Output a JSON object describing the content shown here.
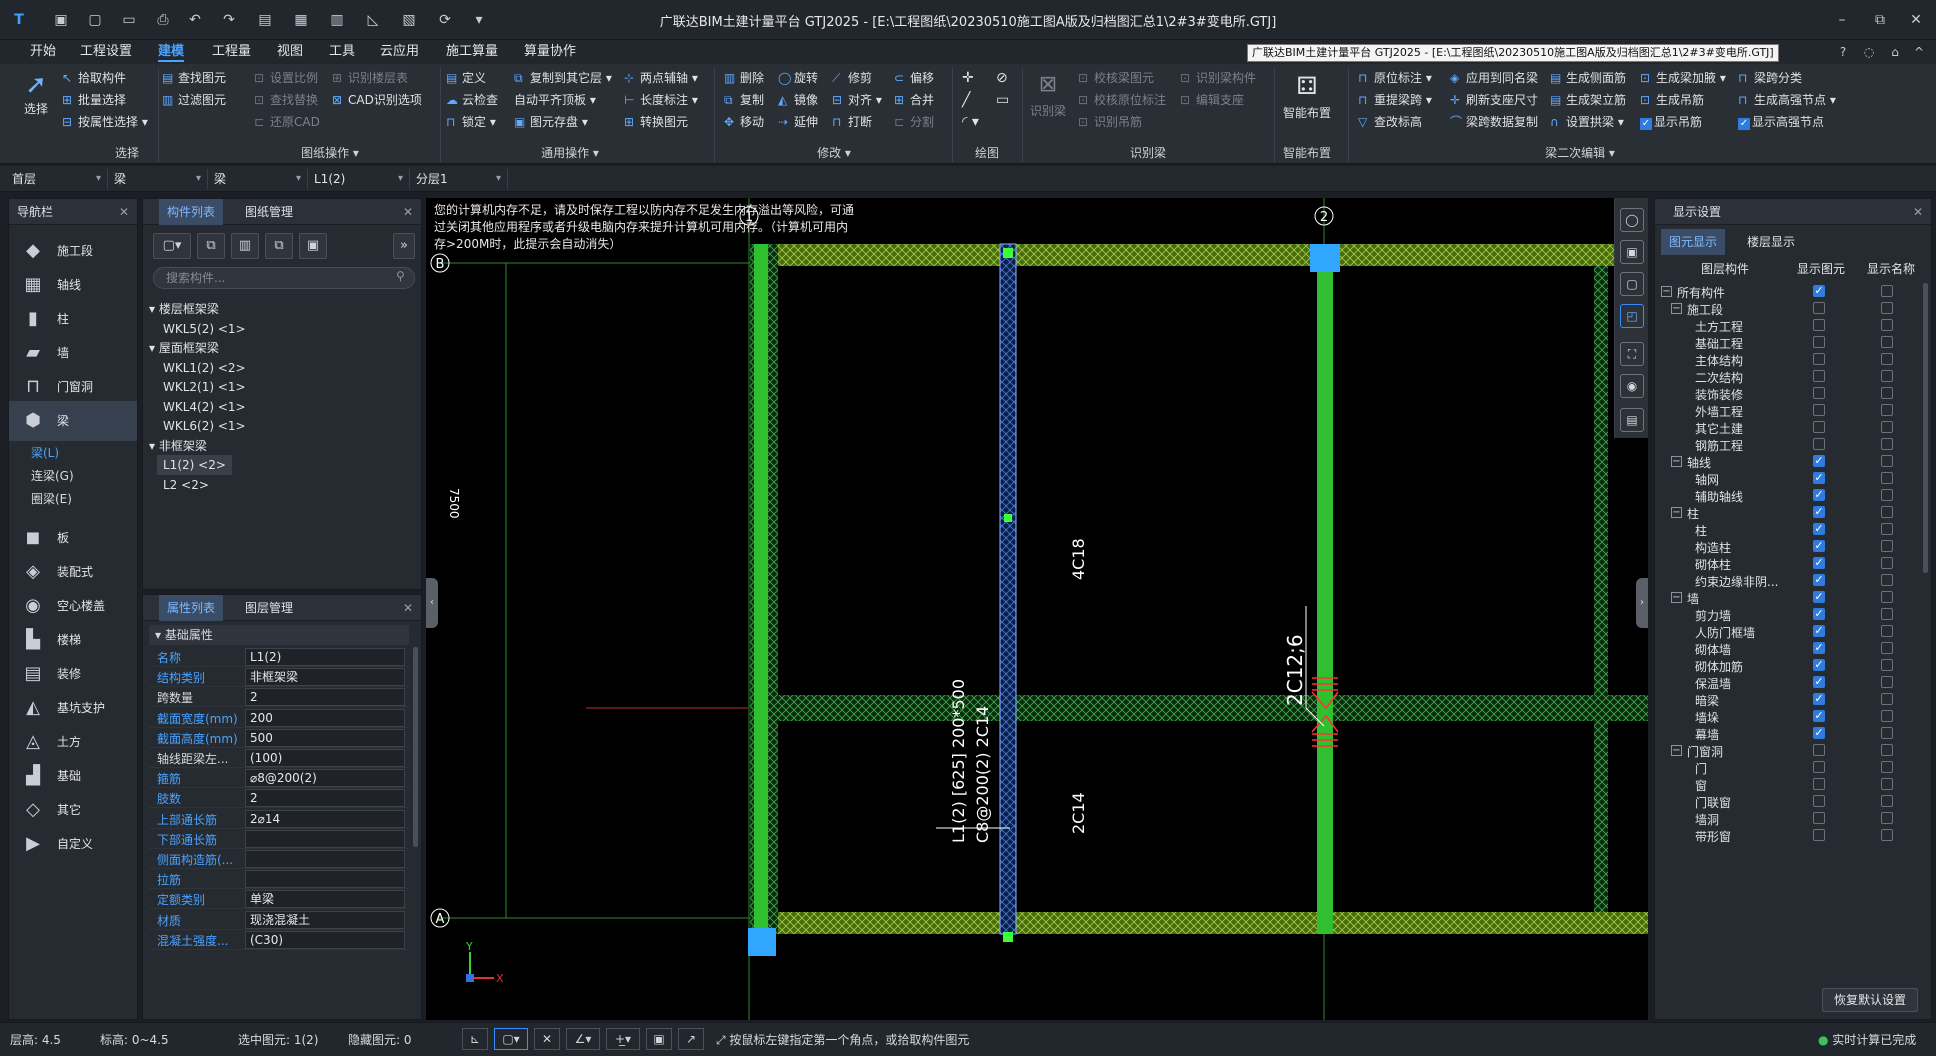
{
  "titlebar": {
    "title": "广联达BIM土建计量平台 GTJ2025 - [E:\\工程图纸\\20230510施工图A版及归档图汇总1\\2#3#变电所.GTJ]",
    "minimize": "–",
    "restore": "⧉",
    "close": "✕"
  },
  "menu": {
    "items": [
      "开始",
      "工程设置",
      "建模",
      "工程量",
      "视图",
      "工具",
      "云应用",
      "施工算量",
      "算量协作"
    ],
    "active": "建模",
    "tooltip": "广联达BIM土建计量平台 GTJ2025 - [E:\\工程图纸\\20230510施工图A版及归档图汇总1\\2#3#变电所.GTJ]"
  },
  "ribbon": {
    "select_big": "选择",
    "select": [
      "拾取构件",
      "批量选择",
      "按属性选择 ▾"
    ],
    "drawing_ops": [
      "查找图元",
      "过滤图元",
      "设置比例",
      "查找替换",
      "还原CAD",
      "识别楼层表",
      "CAD识别选项"
    ],
    "general_ops": [
      "定义",
      "云检查",
      "锁定 ▾",
      "复制到其它层 ▾",
      "自动平齐顶板 ▾",
      "图元存盘 ▾",
      "两点辅轴 ▾",
      "长度标注 ▾",
      "转换图元"
    ],
    "modify": [
      "删除",
      "复制",
      "移动",
      "旋转",
      "镜像",
      "延伸",
      "修剪",
      "对齐 ▾",
      "打断",
      "偏移",
      "合并",
      "分割"
    ],
    "identify_big": "识别梁",
    "identify": [
      "校核梁图元",
      "校核原位标注",
      "识别吊筋",
      "识别梁构件",
      "编辑支座"
    ],
    "smart_big": "智能布置",
    "beam_edit": [
      "原位标注 ▾",
      "重提梁跨 ▾",
      "查改标高",
      "应用到同名梁",
      "刷新支座尺寸",
      "梁跨数据复制",
      "生成侧面筋",
      "生成架立筋",
      "设置拱梁 ▾",
      "生成梁加腋 ▾",
      "生成吊筋",
      "显示吊筋",
      "梁跨分类",
      "生成高强节点 ▾",
      "显示高强节点"
    ],
    "groups": [
      "选择",
      "图纸操作 ▾",
      "通用操作 ▾",
      "修改 ▾",
      "绘图",
      "识别梁",
      "智能布置",
      "梁二次编辑 ▾"
    ]
  },
  "filters": [
    "首层",
    "梁",
    "梁",
    "L1(2)",
    "分层1"
  ],
  "nav": {
    "title": "导航栏",
    "close": "✕",
    "items": [
      {
        "label": "施工段",
        "icon": "construction-segment-icon",
        "glyph": "◆"
      },
      {
        "label": "轴线",
        "icon": "axis-grid-icon",
        "glyph": "▦"
      },
      {
        "label": "柱",
        "icon": "column-icon",
        "glyph": "▮"
      },
      {
        "label": "墙",
        "icon": "wall-icon",
        "glyph": "▰"
      },
      {
        "label": "门窗洞",
        "icon": "door-window-icon",
        "glyph": "⊓"
      },
      {
        "label": "梁",
        "icon": "beam-icon",
        "glyph": "⬢"
      }
    ],
    "subs": [
      "梁(L)",
      "连梁(G)",
      "圈梁(E)"
    ],
    "items2": [
      {
        "label": "板",
        "icon": "slab-icon",
        "glyph": "◼"
      },
      {
        "label": "装配式",
        "icon": "prefab-icon",
        "glyph": "◈"
      },
      {
        "label": "空心楼盖",
        "icon": "hollow-slab-icon",
        "glyph": "◉"
      },
      {
        "label": "楼梯",
        "icon": "stair-icon",
        "glyph": "▙"
      },
      {
        "label": "装修",
        "icon": "decoration-icon",
        "glyph": "▤"
      },
      {
        "label": "基坑支护",
        "icon": "pit-support-icon",
        "glyph": "◭"
      },
      {
        "label": "土方",
        "icon": "earthwork-icon",
        "glyph": "◬"
      },
      {
        "label": "基础",
        "icon": "foundation-icon",
        "glyph": "▟"
      },
      {
        "label": "其它",
        "icon": "other-icon",
        "glyph": "◇"
      },
      {
        "label": "自定义",
        "icon": "custom-icon",
        "glyph": "▶"
      }
    ]
  },
  "complist": {
    "tabs": [
      "构件列表",
      "图纸管理"
    ],
    "close": "✕",
    "search": "搜索构件...",
    "tree": [
      {
        "text": "▾ 楼层框架梁",
        "level": 0
      },
      {
        "text": "WKL5(2) <1>",
        "level": 1
      },
      {
        "text": "▾ 屋面框架梁",
        "level": 0
      },
      {
        "text": "WKL1(2) <2>",
        "level": 1
      },
      {
        "text": "WKL2(1) <1>",
        "level": 1
      },
      {
        "text": "WKL4(2) <1>",
        "level": 1
      },
      {
        "text": "WKL6(2) <1>",
        "level": 1
      },
      {
        "text": "▾ 非框架梁",
        "level": 0
      },
      {
        "text": "L1(2) <2>",
        "level": 1,
        "sel": true
      },
      {
        "text": "L2 <2>",
        "level": 1
      }
    ]
  },
  "props": {
    "tabs": [
      "属性列表",
      "图层管理"
    ],
    "close": "✕",
    "section": "▾ 基础属性",
    "rows": [
      {
        "k": "名称",
        "v": "L1(2)",
        "blue": true
      },
      {
        "k": "结构类别",
        "v": "非框架梁",
        "blue": true
      },
      {
        "k": "跨数量",
        "v": "2",
        "blue": false
      },
      {
        "k": "截面宽度(mm)",
        "v": "200",
        "blue": true
      },
      {
        "k": "截面高度(mm)",
        "v": "500",
        "blue": true
      },
      {
        "k": "轴线距梁左...",
        "v": "(100)",
        "blue": false
      },
      {
        "k": "箍筋",
        "v": "⌀8@200(2)",
        "blue": true
      },
      {
        "k": "肢数",
        "v": "2",
        "blue": true
      },
      {
        "k": "上部通长筋",
        "v": "2⌀14",
        "blue": true
      },
      {
        "k": "下部通长筋",
        "v": "",
        "blue": true
      },
      {
        "k": "侧面构造筋(...",
        "v": "",
        "blue": true
      },
      {
        "k": "拉筋",
        "v": "",
        "blue": true
      },
      {
        "k": "定额类别",
        "v": "单梁",
        "blue": true
      },
      {
        "k": "材质",
        "v": "现浇混凝土",
        "blue": true
      },
      {
        "k": "混凝土强度...",
        "v": "(C30)",
        "blue": true
      }
    ]
  },
  "canvas": {
    "warning": "您的计算机内存不足，请及时保存工程以防内存不足发生内存溢出等风险，可通过关闭其他应用程序或者升级电脑内存来提升计算机可用内存。（计算机可用内存>200M时，此提示会自动消失）",
    "axis_labels": [
      "1",
      "2",
      "B",
      "A"
    ],
    "annotations": [
      "4C18",
      "2C14",
      "L1(2) [625] 200*500",
      "C8@200(2) 2C14",
      "2C12;6"
    ],
    "edge_text": "7500",
    "ucs_x": "X",
    "ucs_y": "Y"
  },
  "vtools": [
    "orbit-icon",
    "cube-top-icon",
    "cube-front-icon",
    "cube-iso-icon",
    "fullscreen-icon",
    "camera-icon",
    "notes-icon"
  ],
  "display": {
    "title": "显示设置",
    "close": "✕",
    "tabs": [
      "图元显示",
      "楼层显示"
    ],
    "headers": [
      "图层构件",
      "显示图元",
      "显示名称"
    ],
    "reset": "恢复默认设置",
    "rows": [
      {
        "t": "所有构件",
        "lv": 0,
        "exp": "−",
        "a": true,
        "b": false
      },
      {
        "t": "施工段",
        "lv": 1,
        "exp": "−",
        "a": false,
        "b": false
      },
      {
        "t": "土方工程",
        "lv": 2,
        "a": false,
        "b": false
      },
      {
        "t": "基础工程",
        "lv": 2,
        "a": false,
        "b": false
      },
      {
        "t": "主体结构",
        "lv": 2,
        "a": false,
        "b": false
      },
      {
        "t": "二次结构",
        "lv": 2,
        "a": false,
        "b": false
      },
      {
        "t": "装饰装修",
        "lv": 2,
        "a": false,
        "b": false
      },
      {
        "t": "外墙工程",
        "lv": 2,
        "a": false,
        "b": false
      },
      {
        "t": "其它土建",
        "lv": 2,
        "a": false,
        "b": false
      },
      {
        "t": "钢筋工程",
        "lv": 2,
        "a": false,
        "b": false
      },
      {
        "t": "轴线",
        "lv": 1,
        "exp": "−",
        "a": true,
        "b": false
      },
      {
        "t": "轴网",
        "lv": 2,
        "a": true,
        "b": false
      },
      {
        "t": "辅助轴线",
        "lv": 2,
        "a": true,
        "b": false
      },
      {
        "t": "柱",
        "lv": 1,
        "exp": "−",
        "a": true,
        "b": false
      },
      {
        "t": "柱",
        "lv": 2,
        "a": true,
        "b": false
      },
      {
        "t": "构造柱",
        "lv": 2,
        "a": true,
        "b": false
      },
      {
        "t": "砌体柱",
        "lv": 2,
        "a": true,
        "b": false
      },
      {
        "t": "约束边缘非阴...",
        "lv": 2,
        "a": true,
        "b": false
      },
      {
        "t": "墙",
        "lv": 1,
        "exp": "−",
        "a": true,
        "b": false
      },
      {
        "t": "剪力墙",
        "lv": 2,
        "a": true,
        "b": false
      },
      {
        "t": "人防门框墙",
        "lv": 2,
        "a": true,
        "b": false
      },
      {
        "t": "砌体墙",
        "lv": 2,
        "a": true,
        "b": false
      },
      {
        "t": "砌体加筋",
        "lv": 2,
        "a": true,
        "b": false
      },
      {
        "t": "保温墙",
        "lv": 2,
        "a": true,
        "b": false
      },
      {
        "t": "暗梁",
        "lv": 2,
        "a": true,
        "b": false
      },
      {
        "t": "墙垛",
        "lv": 2,
        "a": true,
        "b": false
      },
      {
        "t": "幕墙",
        "lv": 2,
        "a": true,
        "b": false
      },
      {
        "t": "门窗洞",
        "lv": 1,
        "exp": "−",
        "a": false,
        "b": false
      },
      {
        "t": "门",
        "lv": 2,
        "a": false,
        "b": false
      },
      {
        "t": "窗",
        "lv": 2,
        "a": false,
        "b": false
      },
      {
        "t": "门联窗",
        "lv": 2,
        "a": false,
        "b": false
      },
      {
        "t": "墙洞",
        "lv": 2,
        "a": false,
        "b": false
      },
      {
        "t": "带形窗",
        "lv": 2,
        "a": false,
        "b": false
      }
    ]
  },
  "status": {
    "floor_height": "层高:  4.5",
    "elevation": "标高:  0~4.5",
    "selected": "选中图元:  1(2)",
    "hidden": "隐藏图元:  0",
    "hint": "按鼠标左键指定第一个角点，或拾取构件图元",
    "realtime": "实时计算已完成"
  }
}
